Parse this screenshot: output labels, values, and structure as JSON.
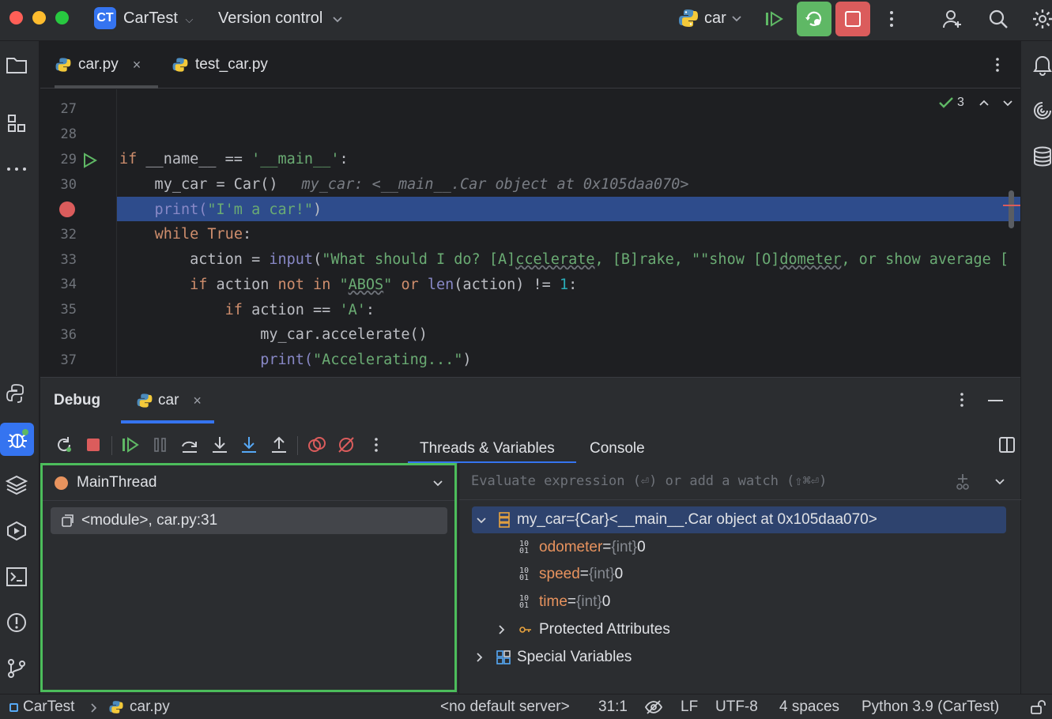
{
  "window": {
    "project_badge": "CT",
    "project_name": "CarTest",
    "vcs_label": "Version control",
    "run_config": "car"
  },
  "editor_tabs": [
    {
      "label": "car.py",
      "active": true
    },
    {
      "label": "test_car.py",
      "active": false
    }
  ],
  "inspections": {
    "count": "3"
  },
  "editor": {
    "lines": [
      {
        "num": "27"
      },
      {
        "num": "28"
      },
      {
        "num": "29"
      },
      {
        "num": "30",
        "inlay": "my_car: <__main__.Car object at 0x105daa070>"
      },
      {
        "num": "31"
      },
      {
        "num": "32"
      },
      {
        "num": "33"
      },
      {
        "num": "34"
      },
      {
        "num": "35"
      },
      {
        "num": "36"
      },
      {
        "num": "37"
      }
    ],
    "code": {
      "l29_a": "if",
      "l29_b": " __name__ == ",
      "l29_c": "'__main__'",
      "l29_d": ":",
      "l30_a": "    my_car = Car()",
      "l31_a": "    print(",
      "l31_b": "\"I'm a car!\"",
      "l31_c": ")",
      "l32_a": "    ",
      "l32_b": "while",
      "l32_c": " ",
      "l32_d": "True",
      "l32_e": ":",
      "l33_a": "        action = ",
      "l33_b": "input",
      "l33_c": "(",
      "l33_d": "\"What should I do? [A]",
      "l33_e": "ccelerate",
      "l33_f": ", [B]rake, \"",
      "l33_g": "\"show [O]",
      "l33_h": "dometer",
      "l33_i": ", or show average [",
      "l34_a": "        ",
      "l34_b": "if",
      "l34_c": " action ",
      "l34_d": "not in",
      "l34_e": " ",
      "l34_f": "\"",
      "l34_g": "ABOS",
      "l34_h": "\"",
      "l34_i": " ",
      "l34_j": "or",
      "l34_k": " ",
      "l34_l": "len",
      "l34_m": "(action) != ",
      "l34_n": "1",
      "l34_o": ":",
      "l35_a": "            ",
      "l35_b": "if",
      "l35_c": " action == ",
      "l35_d": "'A'",
      "l35_e": ":",
      "l36_a": "                my_car.accelerate()",
      "l37_a": "                print(",
      "l37_b": "\"Accelerating...\"",
      "l37_c": ")"
    }
  },
  "debug": {
    "title": "Debug",
    "session_tab": "car",
    "tabs": [
      "Threads & Variables",
      "Console"
    ],
    "thread_selector": "MainThread",
    "frames": [
      {
        "label": "<module>, car.py:31"
      }
    ],
    "evaluate_placeholder": "Evaluate expression (⏎) or add a watch (⇧⌘⏎)",
    "variables": [
      {
        "name": "my_car",
        "eq": " = ",
        "type": "{Car}",
        "value": " <__main__.Car object at 0x105daa070>"
      },
      {
        "name": "odometer",
        "eq": " = ",
        "type": "{int}",
        "value": " 0"
      },
      {
        "name": "speed",
        "eq": " = ",
        "type": "{int}",
        "value": " 0"
      },
      {
        "name": "time",
        "eq": " = ",
        "type": "{int}",
        "value": " 0"
      }
    ],
    "groups": [
      "Protected Attributes",
      "Special Variables"
    ]
  },
  "statusbar": {
    "project": "CarTest",
    "file": "car.py",
    "server": "<no default server>",
    "position": "31:1",
    "line_sep": "LF",
    "encoding": "UTF-8",
    "indent": "4 spaces",
    "interpreter": "Python 3.9 (CarTest)"
  },
  "colors": {
    "accent": "#3574f0",
    "breakpoint": "#db5c5c",
    "run_green": "#5fb865",
    "stop_red": "#db5c5c",
    "highlight_line": "#2e4c8c",
    "frame_border": "#4cbd5b"
  }
}
